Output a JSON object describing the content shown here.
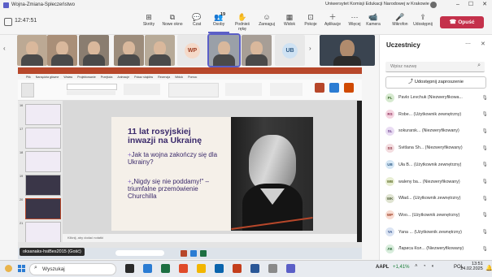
{
  "window": {
    "title": "Wojna-Zmiana-Spłeczeństwo",
    "org": "Uniwersytet Komisji Edukacji Narodowej w Krakowie"
  },
  "meeting": {
    "timer": "12:47:51"
  },
  "toolbar": [
    {
      "label": "Skróty",
      "icon": "shortcuts-icon"
    },
    {
      "label": "Nowe okno",
      "icon": "new-window-icon"
    },
    {
      "label": "Czat",
      "icon": "chat-icon"
    },
    {
      "label": "Osoby",
      "icon": "people-icon",
      "badge": "19"
    },
    {
      "label": "Podnieś rękę",
      "icon": "raise-hand-icon"
    },
    {
      "label": "Zareaguj",
      "icon": "react-icon"
    },
    {
      "label": "Widok",
      "icon": "view-icon"
    },
    {
      "label": "Pokoje",
      "icon": "rooms-icon"
    },
    {
      "label": "Aplikacje",
      "icon": "apps-icon"
    },
    {
      "label": "Więcej",
      "icon": "more-icon"
    },
    {
      "label": "Kamera",
      "icon": "camera-icon"
    },
    {
      "label": "Mikrofon",
      "icon": "microphone-icon"
    },
    {
      "label": "Udostępnij",
      "icon": "share-icon"
    }
  ],
  "leave_label": "Opuść",
  "gallery_tiles": [
    {
      "initials": "",
      "bg": "#bca994"
    },
    {
      "initials": "",
      "bg": "#a98f78"
    },
    {
      "initials": "",
      "bg": "#8a7d70"
    },
    {
      "initials": "",
      "bg": "#9c8c7b"
    },
    {
      "initials": "",
      "bg": "#b7aa98"
    },
    {
      "initials": "WP",
      "bg": "#f5d9c8"
    },
    {
      "initials": "",
      "bg": "#9aa0a8"
    },
    {
      "initials": "",
      "bg": "#a79e96"
    },
    {
      "initials": "UB",
      "bg": "#cfe2f3"
    },
    {
      "initials": "",
      "bg": "#6f7880"
    }
  ],
  "panel": {
    "title": "Uczestnicy",
    "search_placeholder": "Wpisz nazwę",
    "invite_label": "Udostępnij zaproszenie",
    "participants": [
      {
        "initials": "PL",
        "name": "Pavlo Levchuk (Niezweryfikowa...",
        "color": "#d7ead0",
        "fg": "#3d6b2f"
      },
      {
        "initials": "RS",
        "name": "Robe... (Użytkownik zewnętrzny)",
        "color": "#f5d5e1",
        "fg": "#8b2a55"
      },
      {
        "initials": "SL",
        "name": "sokurarsk... (Niezweryfikowany)",
        "color": "#e9dcf3",
        "fg": "#6a3d8a"
      },
      {
        "initials": "SS",
        "name": "Svitlana Sh... (Niezweryfikowany)",
        "color": "#f3dde0",
        "fg": "#8b2a3a"
      },
      {
        "initials": "UB",
        "name": "Uła B... (Użytkownik zewnętrzny)",
        "color": "#d6e7f5",
        "fg": "#2f5b85"
      },
      {
        "initials": "WB",
        "name": "waleny ba... (Niezweryfikowany)",
        "color": "#e8eed3",
        "fg": "#5c6b24"
      },
      {
        "initials": "WK",
        "name": "Wład... (Użytkownik zewnętrzny)",
        "color": "#e0e4d2",
        "fg": "#51603a"
      },
      {
        "initials": "WP",
        "name": "Woo... (Użytkownik zewnętrzny)",
        "color": "#f8dcd2",
        "fg": "#9b3a20"
      },
      {
        "initials": "YA",
        "name": "Yana ... (Użytkownik zewnętrzny)",
        "color": "#dbe4f3",
        "fg": "#30508a"
      },
      {
        "initials": "ЛК",
        "name": "Лариса Кол... (Niezweryfikowany)",
        "color": "#d8eddc",
        "fg": "#2d6a3a"
      }
    ]
  },
  "ppt": {
    "tabs": [
      "Plik",
      "Narzędzia główne",
      "Wstaw",
      "Projektowanie",
      "Przejścia",
      "Animacje",
      "Pokaz slajdów",
      "Recenzja",
      "Widok",
      "Pomoc"
    ],
    "slide_title": "11 lat rosyjskiej inwazji na Ukrainę",
    "bullet1": "Jak ta wojna zakończy się dla Ukrainy?",
    "bullet2": "„Nigdy się nie poddamy!\" – triumfalne przemówienie Churchilla",
    "notes_placeholder": "Kliknij, aby dodać notatki",
    "thumb_numbers": [
      "16",
      "17",
      "18",
      "19",
      "20",
      "21"
    ],
    "presenter_label": "oksanaks-hsiBes2015 (Gość)"
  },
  "taskbar": {
    "search_placeholder": "Wyszukaj",
    "ticker": "AAPL",
    "ticker_change": "+1,41%",
    "lang": "POL",
    "time": "13:51",
    "date": "24.02.2025"
  }
}
